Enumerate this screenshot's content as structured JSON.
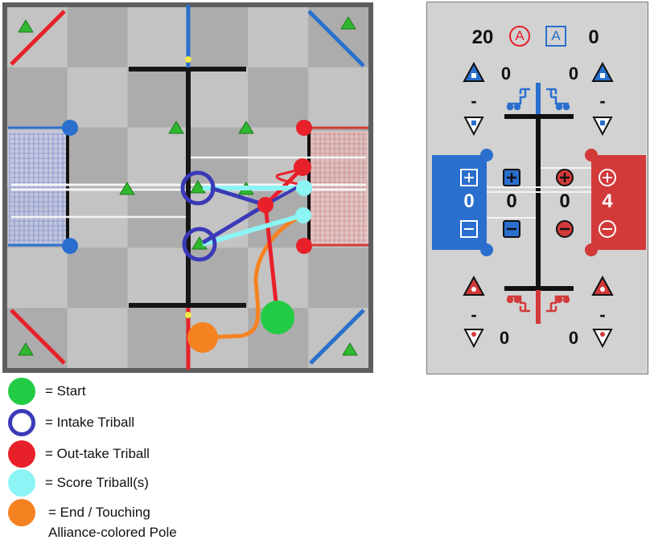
{
  "legend": {
    "start": "= Start",
    "intake": "= Intake Triball",
    "outtake": "= Out-take Triball",
    "score": "= Score Triball(s)",
    "end_line1": "= End / Touching",
    "end_line2": "Alliance-colored Pole"
  },
  "legend_colors": {
    "start": "#22cc44",
    "intake": "#3a3ab8",
    "outtake": "#e8202a",
    "score": "#8cf4f4",
    "end": "#f58220"
  },
  "scoreboard": {
    "red_total": "20",
    "red_badge": "A",
    "blue_badge": "A",
    "blue_total": "0",
    "blue_left_count": "0",
    "blue_right_count": "0",
    "blue_left_dash": "-",
    "blue_right_dash": "-",
    "blue_goal_value": "0",
    "blue_alliance_value": "0",
    "red_alliance_value": "0",
    "red_goal_value": "4",
    "red_left_dash": "-",
    "red_right_dash": "-",
    "red_left_count": "0",
    "red_right_count": "0"
  },
  "colors": {
    "blue": "#2a6fce",
    "red": "#d23a3a",
    "panel_bg": "#d2d2d2",
    "path_blue": "#3a3ab8",
    "path_cyan": "#8cf4f4",
    "path_red": "#e8202a",
    "path_orange": "#f58220",
    "start_green": "#22cc44"
  }
}
